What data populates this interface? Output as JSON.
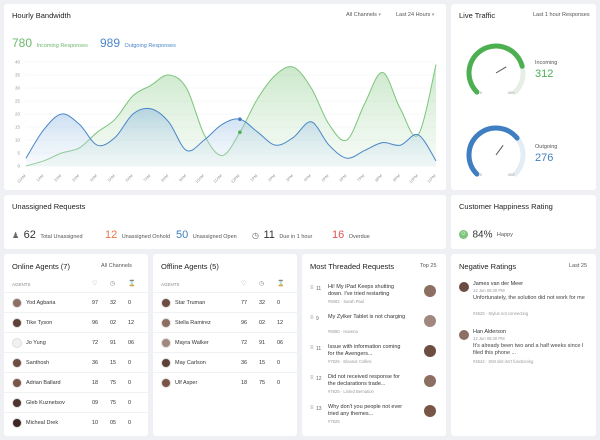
{
  "bandwidth": {
    "title": "Hourly Bandwidth",
    "filter_channels": "All Channels",
    "filter_time": "Last 24 Hours",
    "incoming_value": "780",
    "incoming_label": "Incoming Responses",
    "outgoing_value": "989",
    "outgoing_label": "Outgoing Responses",
    "incoming_color": "#7cc47c",
    "outgoing_color": "#4a86c8"
  },
  "chart_data": {
    "type": "area",
    "yticks": [
      "40",
      "35",
      "30",
      "25",
      "20",
      "15",
      "10",
      "5",
      "0"
    ],
    "ylim": [
      0,
      40
    ],
    "categories": [
      "12AM",
      "1AM",
      "2AM",
      "3AM",
      "4AM",
      "5AM",
      "6AM",
      "7AM",
      "8AM",
      "9AM",
      "10AM",
      "11AM",
      "12PM",
      "1PM",
      "2PM",
      "3PM",
      "4PM",
      "5PM",
      "6PM",
      "7PM",
      "8PM",
      "9PM",
      "10PM",
      "11PM"
    ],
    "series": [
      {
        "name": "Incoming Responses",
        "values": [
          0,
          2,
          5,
          7,
          13,
          18,
          27,
          31,
          35,
          30,
          12,
          4,
          13,
          26,
          35,
          38,
          30,
          16,
          10,
          24,
          36,
          22,
          12,
          39
        ]
      },
      {
        "name": "Outgoing Responses",
        "values": [
          3,
          14,
          20,
          16,
          8,
          11,
          20,
          22,
          17,
          6,
          10,
          16,
          18,
          13,
          8,
          11,
          17,
          8,
          3,
          6,
          9,
          8,
          12,
          2
        ]
      }
    ]
  },
  "live_traffic": {
    "title": "Live Traffic",
    "filter": "Last 1 hour Responses",
    "incoming_label": "Incoming",
    "incoming_value": "312",
    "outgoing_label": "Outgoing",
    "outgoing_value": "276",
    "gauge_min": "0",
    "gauge_max": "400",
    "incoming_fraction": 0.78,
    "outgoing_fraction": 0.69
  },
  "unassigned": {
    "title": "Unassigned Requests",
    "total_value": "62",
    "total_label": "Total Unassigned",
    "onhold_value": "12",
    "onhold_label": "Unassigned Onhold",
    "open_value": "50",
    "open_label": "Unassigned Open",
    "due_value": "11",
    "due_label": "Due in 1 hour",
    "overdue_value": "16",
    "overdue_label": "Overdue"
  },
  "happiness": {
    "title": "Customer Happiness Rating",
    "value": "84%",
    "label": "Happy"
  },
  "online_agents": {
    "title": "Online Agents (7)",
    "filter": "All Channels",
    "col_label": "AGENTS",
    "rows": [
      {
        "name": "Yod Agbaria",
        "a": "97",
        "b": "32",
        "c": "0",
        "color": "#8d6e63"
      },
      {
        "name": "Tike Tyson",
        "a": "96",
        "b": "02",
        "c": "12",
        "color": "#5d4037"
      },
      {
        "name": "Jo Yung",
        "a": "72",
        "b": "91",
        "c": "06",
        "color": "#f1f1f1"
      },
      {
        "name": "Santhosh",
        "a": "36",
        "b": "15",
        "c": "0",
        "color": "#6d4c41"
      },
      {
        "name": "Adrian Ballard",
        "a": "18",
        "b": "75",
        "c": "0",
        "color": "#795548"
      },
      {
        "name": "Gleb Kuznetsov",
        "a": "09",
        "b": "75",
        "c": "0",
        "color": "#4e342e"
      },
      {
        "name": "Micheal Drek",
        "a": "10",
        "b": "05",
        "c": "0",
        "color": "#3e2723"
      }
    ]
  },
  "offline_agents": {
    "title": "Offline Agents (5)",
    "col_label": "AGENTS",
    "rows": [
      {
        "name": "Star Truman",
        "a": "77",
        "b": "32",
        "c": "0",
        "color": "#6d4c41"
      },
      {
        "name": "Stella Ramirez",
        "a": "96",
        "b": "02",
        "c": "12",
        "color": "#8d6e63"
      },
      {
        "name": "Mayra Walker",
        "a": "72",
        "b": "91",
        "c": "06",
        "color": "#a1887f"
      },
      {
        "name": "May Carlson",
        "a": "36",
        "b": "15",
        "c": "0",
        "color": "#5d4037"
      },
      {
        "name": "Ulf Asper",
        "a": "18",
        "b": "75",
        "c": "0",
        "color": "#795548"
      }
    ]
  },
  "threaded": {
    "title": "Most Threaded Requests",
    "filter": "Top 25",
    "items": [
      {
        "count": "11",
        "text": "Hi! My iPad Keeps shutting down. I've tried restarting",
        "meta": "#5082 · Sarah Paul",
        "color": "#8d6e63"
      },
      {
        "count": "9",
        "text": "My Zylker Tablet is not charging",
        "meta": "#5080 · Havena",
        "color": "#a1887f"
      },
      {
        "count": "11",
        "text": "Issue with information coming for the Avengers...",
        "meta": "#7825 · Eleanor Collins",
        "color": "#6d4c41"
      },
      {
        "count": "12",
        "text": "Did not received response for the declarations trade...",
        "meta": "#7825 · Linted Bernation",
        "color": "#8d6e63"
      },
      {
        "count": "13",
        "text": "Why don't you people not ever tried any themes...",
        "meta": "#7825",
        "color": "#795548"
      }
    ]
  },
  "ratings": {
    "title": "Negative Ratings",
    "filter": "Last 25",
    "items": [
      {
        "name": "James van der Meer",
        "time": "12 Jun 06:30 PM",
        "text": "Unfortunately, the solution did not work for me",
        "meta": "#4625 · Stylus not connecting",
        "color": "#6d4c41"
      },
      {
        "name": "Han Alderson",
        "time": "12 Jun 06:30 PM",
        "text": "It's already been two and a half weeks since I filed this phone ...",
        "meta": "#4542 · SIM slot isn't functioning",
        "color": "#8d6e63"
      }
    ]
  }
}
